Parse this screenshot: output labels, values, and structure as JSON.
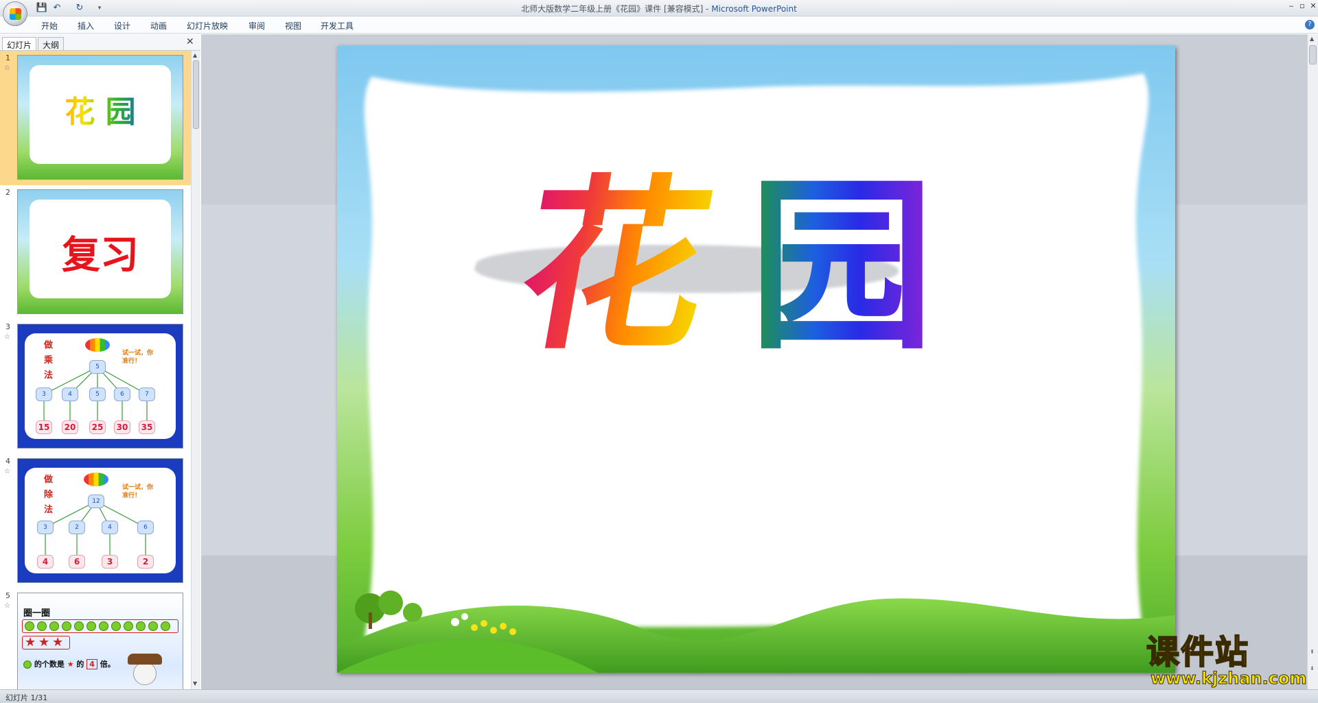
{
  "window": {
    "title": "北师大版数学二年级上册《花园》课件 [兼容模式]",
    "app_name": "Microsoft PowerPoint",
    "controls": {
      "minimize": "‒",
      "maximize": "▫",
      "close": "✕"
    }
  },
  "quick_access": {
    "save_icon": "💾",
    "undo_icon": "↶",
    "redo_icon": "↻",
    "more_icon": "▾"
  },
  "ribbon_tabs": [
    "开始",
    "插入",
    "设计",
    "动画",
    "幻灯片放映",
    "审阅",
    "视图",
    "开发工具"
  ],
  "help_label": "?",
  "pane": {
    "tabs": [
      "幻灯片",
      "大纲"
    ],
    "close_label": "✕"
  },
  "thumbnails": [
    {
      "number": "1",
      "title": "花 园"
    },
    {
      "number": "2",
      "title": "复习"
    },
    {
      "number": "3",
      "label": "做乘法",
      "hint": "试一试，你准行！",
      "root": "5",
      "factors": [
        "3",
        "4",
        "5",
        "6",
        "7"
      ],
      "results": [
        "15",
        "20",
        "25",
        "30",
        "35"
      ]
    },
    {
      "number": "4",
      "label": "做除法",
      "hint": "试一试，你准行！",
      "root": "12",
      "factors": [
        "3",
        "2",
        "4",
        "6"
      ],
      "results": [
        "4",
        "6",
        "3",
        "2"
      ]
    },
    {
      "number": "5",
      "heading": "圈一圈",
      "sentence_a": "的个数是",
      "sentence_b": "的",
      "multiple": "4",
      "sentence_c": "倍。"
    }
  ],
  "slide": {
    "title_char_1": "花",
    "title_char_2": "园"
  },
  "status": {
    "slide_counter": "幻灯片 1/31"
  },
  "watermark": {
    "name": "课件站",
    "url": "www.kjzhan.com"
  },
  "colors": {
    "sky": "#8fd0ef",
    "grass": "#6cc13a",
    "workspace": "#d1d6de",
    "selection": "#fbd88c",
    "thumb_red_title": "#e8141c"
  }
}
